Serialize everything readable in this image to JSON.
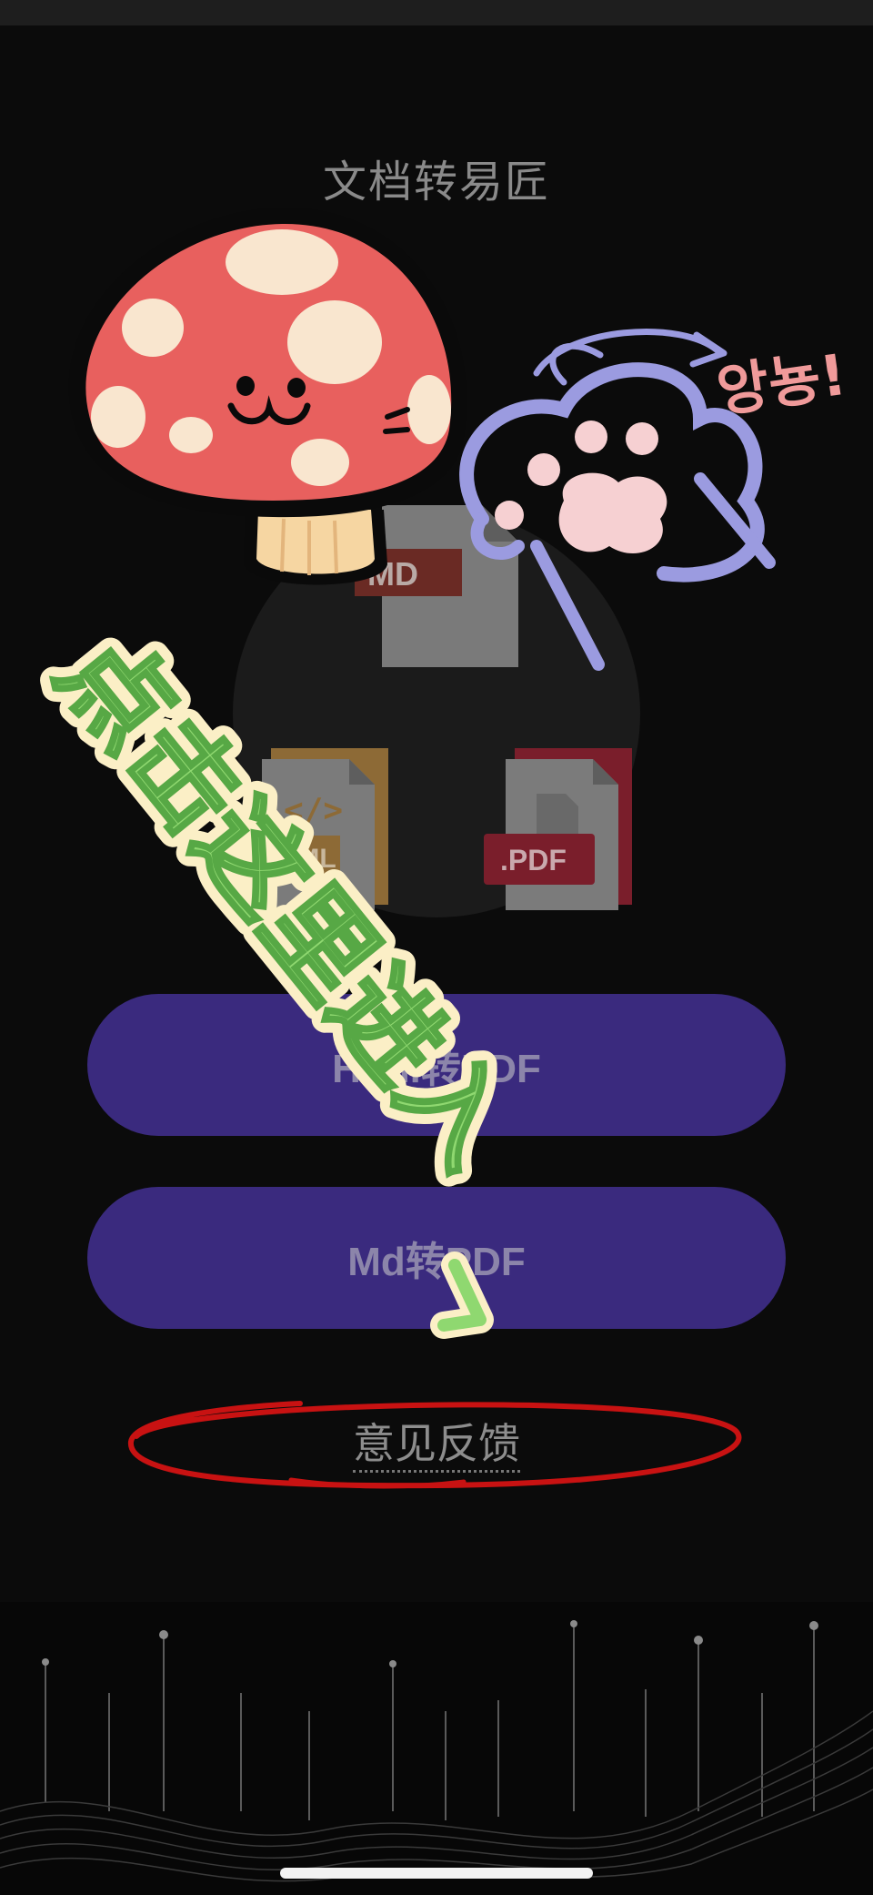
{
  "app": {
    "title": "文档转易匠"
  },
  "file_icons": {
    "md_label": "MD",
    "html_label": "TML",
    "pdf_label": ".PDF"
  },
  "buttons": {
    "html_to_pdf": "Html转PDF",
    "md_to_pdf": "Md转PDF"
  },
  "feedback": {
    "label": "意见反馈"
  },
  "stickers": {
    "arrow_text": "点击这里进入",
    "korean_text": "앙뇽!"
  },
  "colors": {
    "background": "#0b0b0b",
    "button": "#3a2a7e",
    "mushroom": "#e8605e",
    "highlight_circle": "#d01616",
    "sticker_green": "#8fd870"
  }
}
